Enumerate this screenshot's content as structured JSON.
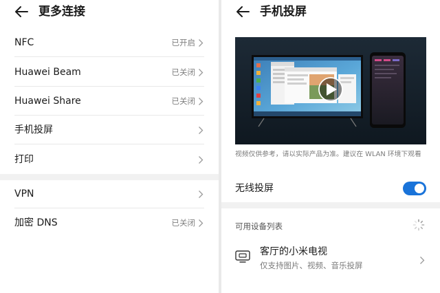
{
  "left": {
    "title": "更多连接",
    "items": [
      {
        "label": "NFC",
        "status": "已开启"
      },
      {
        "label": "Huawei Beam",
        "status": "已关闭"
      },
      {
        "label": "Huawei Share",
        "status": "已关闭"
      },
      {
        "label": "手机投屏",
        "status": ""
      },
      {
        "label": "打印",
        "status": ""
      },
      {
        "label": "VPN",
        "status": ""
      },
      {
        "label": "加密 DNS",
        "status": "已关闭"
      }
    ]
  },
  "right": {
    "title": "手机投屏",
    "video_icon": "play-icon",
    "caption": "视频仅供参考，请以实际产品为准。建议在 WLAN 环境下观看",
    "wireless": {
      "label": "无线投屏",
      "enabled": true
    },
    "devices_header": "可用设备列表",
    "device": {
      "name": "客厅的小米电视",
      "desc": "仅支持图片、视频、音乐投屏"
    }
  },
  "colors": {
    "accent": "#1973d9",
    "secondary_text": "#808080",
    "divider": "#e8e8e8"
  }
}
